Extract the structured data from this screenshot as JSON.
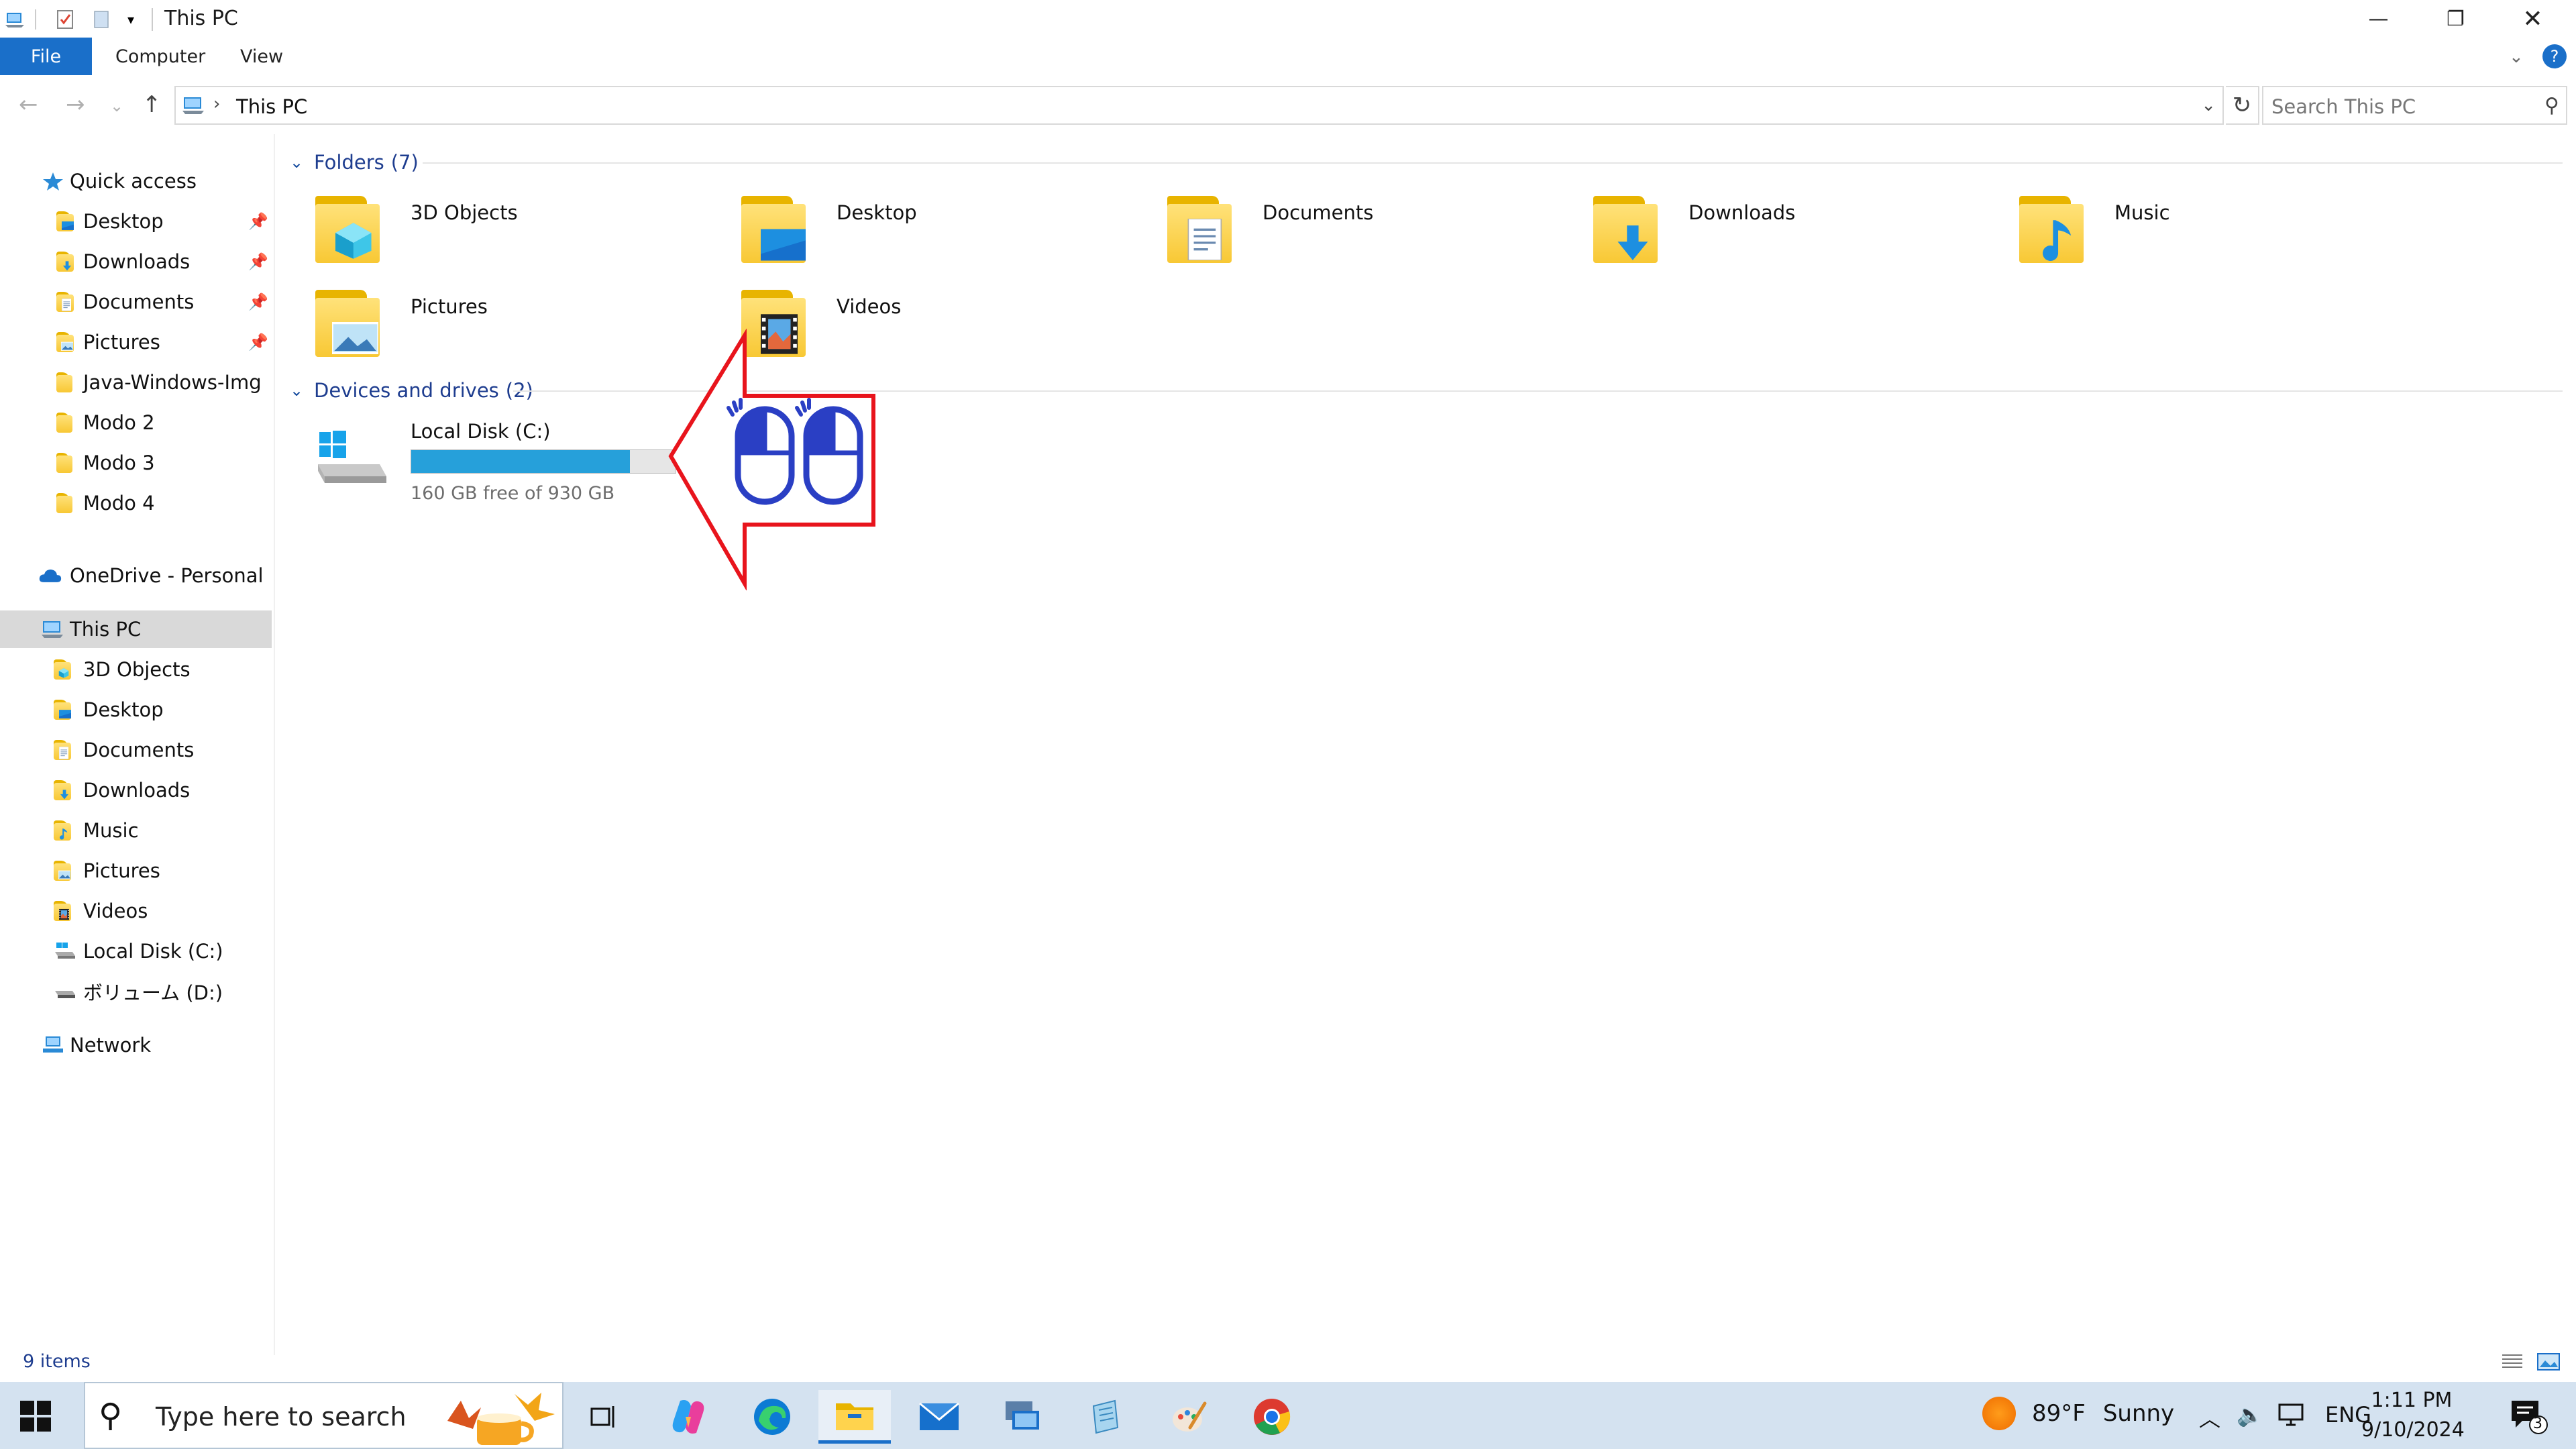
{
  "window": {
    "title": "This PC"
  },
  "ribbon": {
    "tabs": [
      "File",
      "Computer",
      "View"
    ],
    "help": "?"
  },
  "address": {
    "path": "This PC",
    "search_placeholder": "Search This PC"
  },
  "sidebar": {
    "quick_access": {
      "label": "Quick access",
      "items": [
        {
          "label": "Desktop",
          "pinned": true
        },
        {
          "label": "Downloads",
          "pinned": true
        },
        {
          "label": "Documents",
          "pinned": true
        },
        {
          "label": "Pictures",
          "pinned": true
        },
        {
          "label": "Java-Windows-Img",
          "pinned": false
        },
        {
          "label": "Modo 2",
          "pinned": false
        },
        {
          "label": "Modo 3",
          "pinned": false
        },
        {
          "label": "Modo 4",
          "pinned": false
        }
      ]
    },
    "onedrive": {
      "label": "OneDrive - Personal"
    },
    "this_pc": {
      "label": "This PC",
      "items": [
        "3D Objects",
        "Desktop",
        "Documents",
        "Downloads",
        "Music",
        "Pictures",
        "Videos",
        "Local Disk (C:)",
        "ボリューム (D:)"
      ]
    },
    "network": {
      "label": "Network"
    }
  },
  "content": {
    "folders_group": {
      "title": "Folders",
      "count": "(7)"
    },
    "folders": [
      {
        "label": "3D Objects",
        "icon": "3d-objects-folder-icon"
      },
      {
        "label": "Desktop",
        "icon": "desktop-folder-icon"
      },
      {
        "label": "Documents",
        "icon": "documents-folder-icon"
      },
      {
        "label": "Downloads",
        "icon": "downloads-folder-icon"
      },
      {
        "label": "Music",
        "icon": "music-folder-icon"
      },
      {
        "label": "Pictures",
        "icon": "pictures-folder-icon"
      },
      {
        "label": "Videos",
        "icon": "videos-folder-icon"
      }
    ],
    "drives_group": {
      "title": "Devices and drives",
      "count": "(2)"
    },
    "drive": {
      "label": "Local Disk (C:)",
      "free_text": "160 GB free of 930 GB",
      "used_fraction": 0.828
    }
  },
  "status": {
    "items_text": "9 items"
  },
  "taskbar": {
    "search_placeholder": "Type here to search",
    "weather": {
      "temp": "89°F",
      "condition": "Sunny"
    },
    "language": "ENG",
    "time": "1:11 PM",
    "date": "9/10/2024",
    "notifications": "3"
  },
  "colors": {
    "accent": "#1a6fc9",
    "drive_bar": "#26a0da",
    "overlay_arrow": "#e8141c",
    "overlay_mouse": "#2a3fc4"
  }
}
